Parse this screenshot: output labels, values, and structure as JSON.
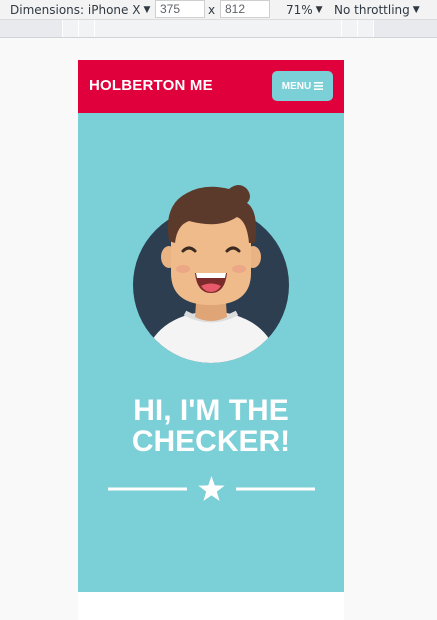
{
  "devtools": {
    "dimensions_label": "Dimensions: iPhone X",
    "width_value": "375",
    "times_symbol": "x",
    "height_value": "812",
    "zoom": "71%",
    "throttling": "No throttling"
  },
  "navbar": {
    "brand": "HOLBERTON ME",
    "menu_label": "MENU",
    "menu_icon": "hamburger-icon"
  },
  "hero": {
    "avatar_icon": "avatar-illustration",
    "title_line1": "HI, I'M THE",
    "title_line2": "CHECKER!",
    "divider_icon": "star-icon"
  },
  "colors": {
    "navbar_bg": "#e0003c",
    "hero_bg": "#7bcfd6",
    "avatar_circle": "#2c3e50"
  }
}
